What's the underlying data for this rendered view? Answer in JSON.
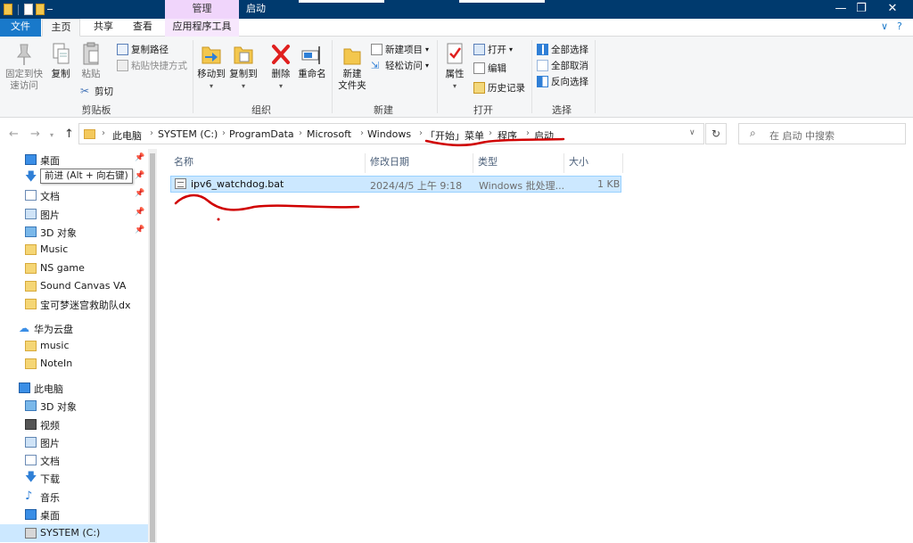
{
  "titlebar": {
    "context_tab_group": "管理",
    "window_title": "启动",
    "controls": {
      "minimize": "—",
      "maximize": "❐",
      "close": "✕"
    }
  },
  "ribbon_tabs": {
    "file": "文件",
    "home": "主页",
    "share": "共享",
    "view": "查看",
    "app_tools": "应用程序工具",
    "collapse": "∨",
    "help": "?"
  },
  "ribbon": {
    "clipboard": {
      "pin_quick": "固定到快速访问",
      "pin_quick_l1": "固定到快",
      "pin_quick_l2": "速访问",
      "copy": "复制",
      "paste": "粘贴",
      "copy_path": "复制路径",
      "paste_shortcut": "粘贴快捷方式",
      "cut": "剪切",
      "label": "剪贴板"
    },
    "organize": {
      "move_to": "移动到",
      "copy_to": "复制到",
      "delete": "删除",
      "rename": "重命名",
      "label": "组织"
    },
    "new": {
      "new_folder_l1": "新建",
      "new_folder_l2": "文件夹",
      "new_item": "新建项目",
      "easy_access": "轻松访问",
      "label": "新建"
    },
    "open": {
      "properties": "属性",
      "open": "打开",
      "edit": "编辑",
      "history": "历史记录",
      "label": "打开"
    },
    "select": {
      "select_all": "全部选择",
      "select_none": "全部取消",
      "invert": "反向选择",
      "label": "选择"
    }
  },
  "address": {
    "crumbs": [
      "此电脑",
      "SYSTEM (C:)",
      "ProgramData",
      "Microsoft",
      "Windows",
      "「开始」菜单",
      "程序",
      "启动"
    ],
    "search_placeholder": "在 启动 中搜索"
  },
  "tooltip": "前进 (Alt + 向右键)",
  "navpane": {
    "quick_access": [
      {
        "label": "桌面",
        "pinned": true
      },
      {
        "label": "下载",
        "pinned": true
      },
      {
        "label": "文档",
        "pinned": true
      },
      {
        "label": "图片",
        "pinned": true
      },
      {
        "label": "3D 对象",
        "pinned": true
      },
      {
        "label": "Music"
      },
      {
        "label": "NS game"
      },
      {
        "label": "Sound Canvas VA"
      },
      {
        "label": "宝可梦迷宫救助队dx"
      }
    ],
    "cloud": {
      "label": "华为云盘"
    },
    "cloud_items": [
      {
        "label": "music"
      },
      {
        "label": "NoteIn"
      }
    ],
    "this_pc": {
      "label": "此电脑"
    },
    "pc_items": [
      {
        "label": "3D 对象"
      },
      {
        "label": "视频"
      },
      {
        "label": "图片"
      },
      {
        "label": "文档"
      },
      {
        "label": "下载"
      },
      {
        "label": "音乐"
      },
      {
        "label": "桌面"
      },
      {
        "label": "SYSTEM (C:)"
      }
    ]
  },
  "filelist": {
    "columns": {
      "name": "名称",
      "modified": "修改日期",
      "type": "类型",
      "size": "大小"
    },
    "files": [
      {
        "name": "ipv6_watchdog.bat",
        "modified": "2024/4/5 上午 9:18",
        "type": "Windows 批处理...",
        "size": "1 KB"
      }
    ]
  },
  "colors": {
    "titlebar": "#003a6e",
    "accent": "#1979ca",
    "context_tab": "#f0d5fb",
    "selection": "#cce8ff",
    "annotation_red": "#d00000"
  }
}
